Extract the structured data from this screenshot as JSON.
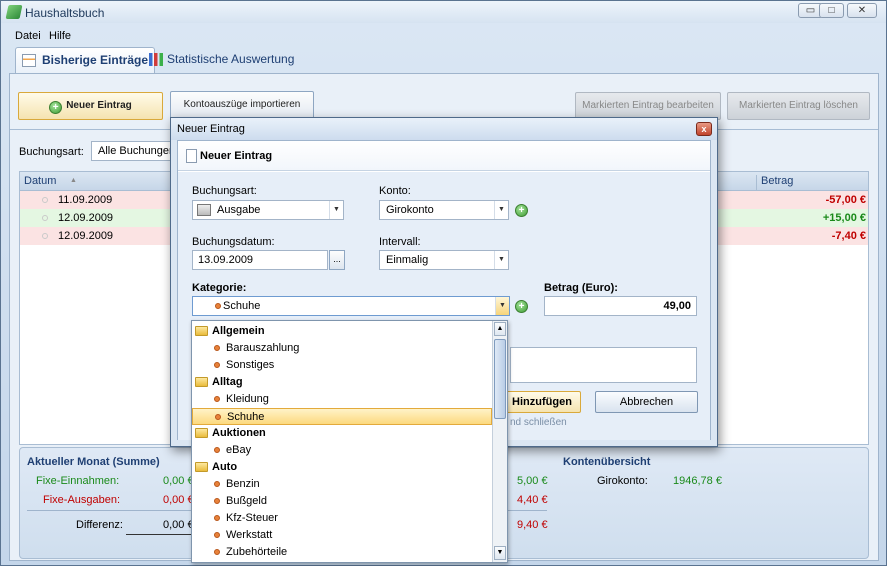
{
  "window": {
    "title": "Haushaltsbuch",
    "minimize": "▭",
    "maximize": "□",
    "close": "✕"
  },
  "menu": [
    "Datei",
    "Hilfe"
  ],
  "tabs": [
    {
      "label": "Bisherige Einträge",
      "selected": true
    },
    {
      "label": "Statistische Auswertung",
      "selected": false
    }
  ],
  "toolbar": {
    "new_entry": "Neuer Eintrag",
    "import": "Kontoauszüge importieren",
    "edit_marked": "Markierten Eintrag bearbeiten",
    "delete_marked": "Markierten Eintrag löschen"
  },
  "filter": {
    "label": "Buchungsart:",
    "value": "Alle Buchungen"
  },
  "grid": {
    "columns": [
      "Datum",
      "Betrag"
    ],
    "sort_indicator": "▲",
    "rows": [
      {
        "date": "11.09.2009",
        "amount": "-57,00 €",
        "type": "expense"
      },
      {
        "date": "12.09.2009",
        "amount": "+15,00 €",
        "type": "income"
      },
      {
        "date": "12.09.2009",
        "amount": "-7,40 €",
        "type": "expense"
      }
    ]
  },
  "summary": {
    "month_title": "Aktueller Monat (Summe)",
    "fixed_income_label": "Fixe-Einnahmen:",
    "fixed_income_value": "0,00 €",
    "fixed_expense_label": "Fixe-Ausgaben:",
    "fixed_expense_value": "0,00 €",
    "difference_label": "Differenz:",
    "difference_value": "0,00 €",
    "col2_income": "5,00 €",
    "col2_expense": "4,40 €",
    "col2_diff": "9,40 €",
    "accounts_title": "Kontenübersicht",
    "account_label": "Girokonto:",
    "account_value": "1946,78 €"
  },
  "dialog": {
    "title": "Neuer Eintrag",
    "close": "x",
    "header": "Neuer Eintrag",
    "booking_type_label": "Buchungsart:",
    "booking_type_value": "Ausgabe",
    "account_label": "Konto:",
    "account_value": "Girokonto",
    "date_label": "Buchungsdatum:",
    "date_value": "13.09.2009",
    "date_button": "...",
    "interval_label": "Intervall:",
    "interval_value": "Einmalig",
    "category_label": "Kategorie:",
    "category_value": "Schuhe",
    "amount_label": "Betrag (Euro):",
    "amount_value": "49,00",
    "add_button": "Hinzufügen",
    "cancel_button": "Abbrechen",
    "close_after_hint": "nd schließen",
    "plus": "+"
  },
  "category_list": [
    {
      "label": "Allgemein",
      "group": true
    },
    {
      "label": "Barauszahlung",
      "group": false
    },
    {
      "label": "Sonstiges",
      "group": false
    },
    {
      "label": "Alltag",
      "group": true
    },
    {
      "label": "Kleidung",
      "group": false
    },
    {
      "label": "Schuhe",
      "group": false,
      "selected": true
    },
    {
      "label": "Auktionen",
      "group": true
    },
    {
      "label": "eBay",
      "group": false
    },
    {
      "label": "Auto",
      "group": true
    },
    {
      "label": "Benzin",
      "group": false
    },
    {
      "label": "Bußgeld",
      "group": false
    },
    {
      "label": "Kfz-Steuer",
      "group": false
    },
    {
      "label": "Werkstatt",
      "group": false
    },
    {
      "label": "Zubehörteile",
      "group": false
    }
  ],
  "colors": {
    "expense": "#c00000",
    "income": "#1a8a1a",
    "expense_row": "#fbe3e3",
    "income_row": "#e4f7e2"
  }
}
